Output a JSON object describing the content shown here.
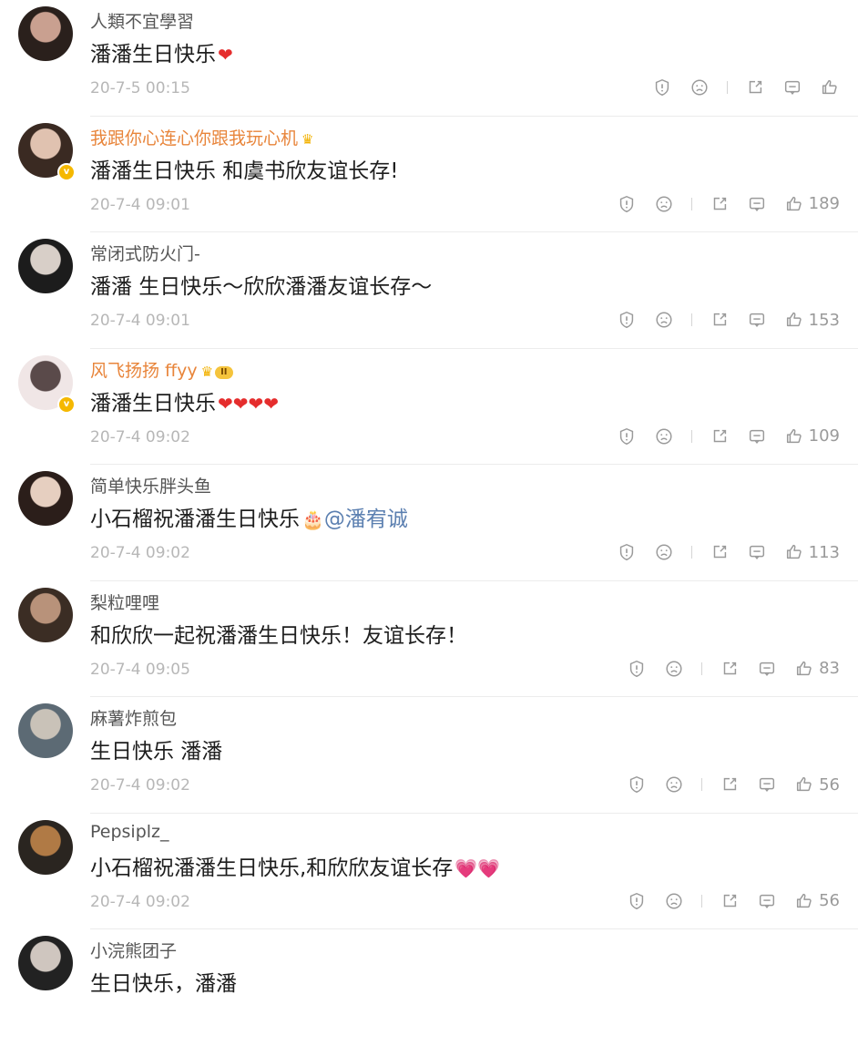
{
  "comments": [
    {
      "username": "人類不宜學習",
      "vip": false,
      "verified": false,
      "crown": false,
      "level": "",
      "text_parts": [
        {
          "text": "潘潘生日快乐"
        },
        {
          "text": "❤",
          "cls": "emo heart"
        }
      ],
      "time": "20-7-5 00:15",
      "likes": "",
      "avatar_colors": [
        "#2a201c",
        "#c9a090"
      ]
    },
    {
      "username": "我跟你心连心你跟我玩心机",
      "vip": true,
      "verified": true,
      "crown": true,
      "level": "",
      "text_parts": [
        {
          "text": "潘潘生日快乐 和虞书欣友谊长存!"
        }
      ],
      "time": "20-7-4 09:01",
      "likes": "189",
      "avatar_colors": [
        "#3a2a22",
        "#e0c2b0"
      ]
    },
    {
      "username": "常闭式防火门-",
      "vip": false,
      "verified": false,
      "crown": false,
      "level": "",
      "text_parts": [
        {
          "text": "潘潘 生日快乐～欣欣潘潘友谊长存～"
        }
      ],
      "time": "20-7-4 09:01",
      "likes": "153",
      "avatar_colors": [
        "#1c1c1c",
        "#d8cfc8"
      ]
    },
    {
      "username": "风飞扬扬 ffyy",
      "vip": true,
      "verified": true,
      "crown": true,
      "level": "II",
      "text_parts": [
        {
          "text": "潘潘生日快乐"
        },
        {
          "text": "❤❤❤❤",
          "cls": "emo heart"
        }
      ],
      "time": "20-7-4 09:02",
      "likes": "109",
      "avatar_colors": [
        "#f0e6e6",
        "#5a4a4a"
      ]
    },
    {
      "username": "简单快乐胖头鱼",
      "vip": false,
      "verified": false,
      "crown": false,
      "level": "",
      "text_parts": [
        {
          "text": "小石榴祝潘潘生日快乐"
        },
        {
          "text": "🎂",
          "cls": "emo"
        },
        {
          "text": "@潘宥诚",
          "cls": "mention"
        }
      ],
      "time": "20-7-4 09:02",
      "likes": "113",
      "avatar_colors": [
        "#2b1e1a",
        "#e6cfc0"
      ]
    },
    {
      "username": "梨粒哩哩",
      "vip": false,
      "verified": false,
      "crown": false,
      "level": "",
      "text_parts": [
        {
          "text": "和欣欣一起祝潘潘生日快乐！友谊长存！"
        }
      ],
      "time": "20-7-4 09:05",
      "likes": "83",
      "avatar_colors": [
        "#3b2d24",
        "#b8927a"
      ]
    },
    {
      "username": "麻薯炸煎包",
      "vip": false,
      "verified": false,
      "crown": false,
      "level": "",
      "text_parts": [
        {
          "text": "生日快乐 潘潘"
        }
      ],
      "time": "20-7-4 09:02",
      "likes": "56",
      "avatar_colors": [
        "#5c6a74",
        "#c9c2b8"
      ]
    },
    {
      "username": "Pepsiplz_",
      "vip": false,
      "verified": false,
      "crown": false,
      "level": "",
      "text_parts": [
        {
          "text": "小石榴祝潘潘生日快乐,和欣欣友谊长存"
        },
        {
          "text": "💗💗",
          "cls": "emo"
        }
      ],
      "time": "20-7-4 09:02",
      "likes": "56",
      "avatar_colors": [
        "#2a2520",
        "#b07a45"
      ]
    },
    {
      "username": "小浣熊团子",
      "vip": false,
      "verified": false,
      "crown": false,
      "level": "",
      "text_parts": [
        {
          "text": "生日快乐，潘潘"
        }
      ],
      "time": "",
      "likes": "",
      "avatar_colors": [
        "#222222",
        "#cfc6bf"
      ]
    }
  ]
}
